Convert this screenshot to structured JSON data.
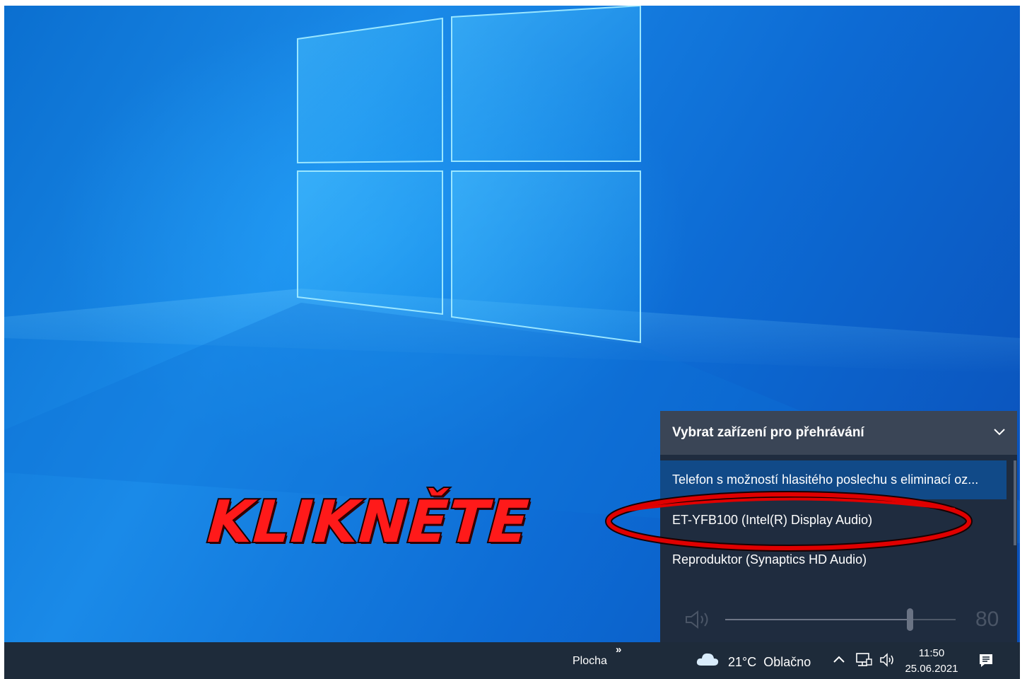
{
  "annotation": {
    "text": "KLIKNĚTE",
    "color": "#ff1a1a"
  },
  "audio_flyout": {
    "title": "Vybrat zařízení pro přehrávání",
    "devices": [
      {
        "label": "Telefon s možností hlasitého poslechu s eliminací oz...",
        "selected": true
      },
      {
        "label": "ET-YFB100 (Intel(R) Display Audio)",
        "selected": false,
        "highlighted": true
      },
      {
        "label": "Reproduktor (Synaptics HD Audio)",
        "selected": false
      }
    ],
    "volume": 80
  },
  "taskbar": {
    "toolbar_label": "Plocha",
    "overflow": "»",
    "weather": {
      "temperature": "21°C",
      "condition": "Oblačno"
    },
    "clock": {
      "time": "11:50",
      "date": "25.06.2021"
    },
    "tray_icons": [
      "chevron-up-icon",
      "network-icon",
      "speaker-icon"
    ],
    "action_center_icon": "notification-icon"
  },
  "colors": {
    "flyout_bg": "#1f2c3f",
    "flyout_header": "#3a4556",
    "selected_item": "#114a88",
    "taskbar_bg": "#1e2b3a",
    "annotation_ring": "#e00000"
  }
}
